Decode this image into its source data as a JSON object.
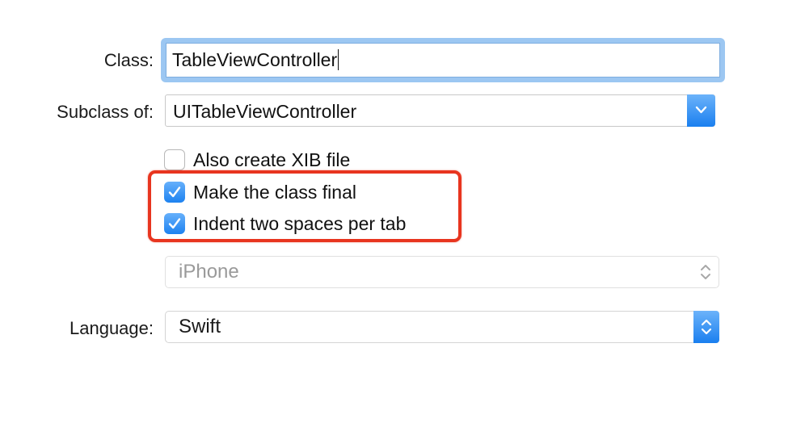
{
  "form": {
    "class_label": "Class:",
    "class_value": "TableViewController",
    "subclass_label": "Subclass of:",
    "subclass_value": "UITableViewController",
    "checkboxes": [
      {
        "label": "Also create XIB file",
        "checked": false
      },
      {
        "label": "Make the class final",
        "checked": true
      },
      {
        "label": "Indent two spaces per tab",
        "checked": true
      }
    ],
    "device_value": "iPhone",
    "language_label": "Language:",
    "language_value": "Swift"
  },
  "colors": {
    "accent": "#1a7fef",
    "focus_ring": "#9cc7f2",
    "highlight": "#e8351f",
    "disabled_text": "#9a9a9a"
  },
  "icons": {
    "subclass_dropdown": "chevron-down-icon",
    "device_popup": "up-down-arrows-icon",
    "language_popup": "up-down-arrows-icon",
    "checkbox_check": "checkmark-icon"
  }
}
